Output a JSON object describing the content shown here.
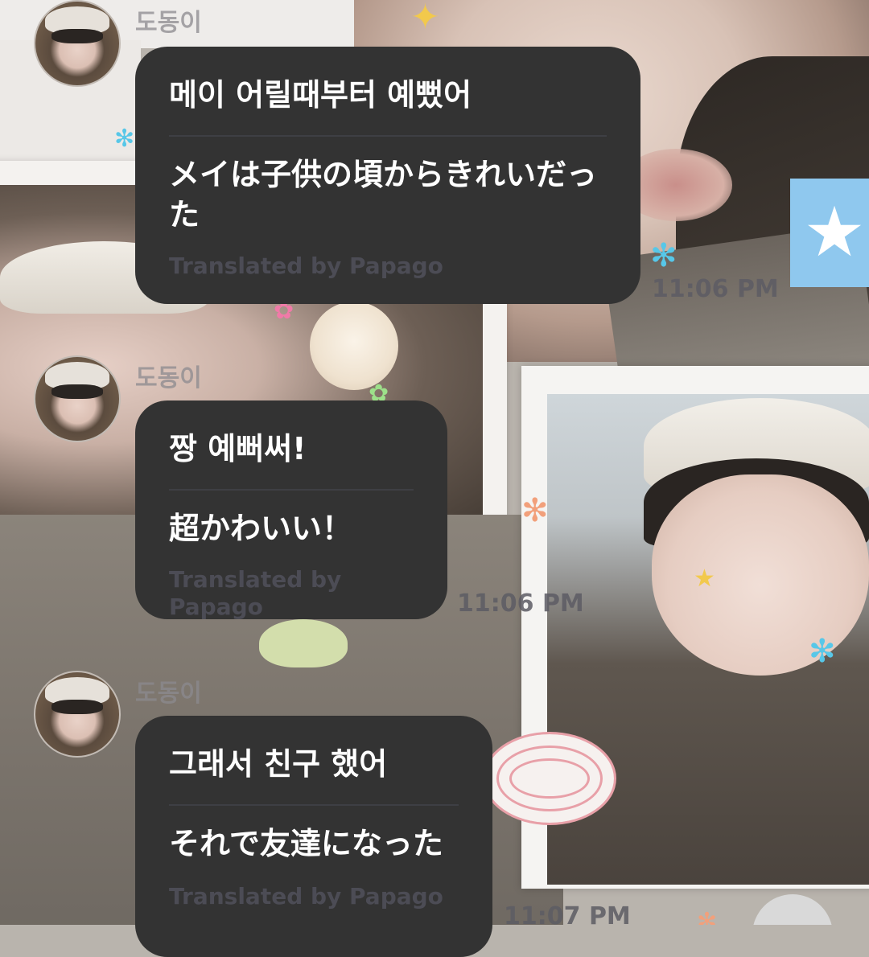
{
  "messages": [
    {
      "sender": "도동이",
      "original": "메이 어릴때부터 예뻤어",
      "translation": "メイは子供の頃からきれいだった",
      "credit": "Translated by Papago",
      "time": "11:06 PM"
    },
    {
      "sender": "도동이",
      "original": "짱 예뻐써!",
      "translation": "超かわいい！",
      "credit": "Translated by Papago",
      "time": "11:06 PM"
    },
    {
      "sender": "도동이",
      "original": "그래서 친구 했어",
      "translation": "それで友達になった",
      "credit": "Translated by Papago",
      "time": "11:07 PM"
    }
  ],
  "colors": {
    "bubble": "#333333",
    "text": "#ffffff",
    "credit": "#4c4c55"
  }
}
